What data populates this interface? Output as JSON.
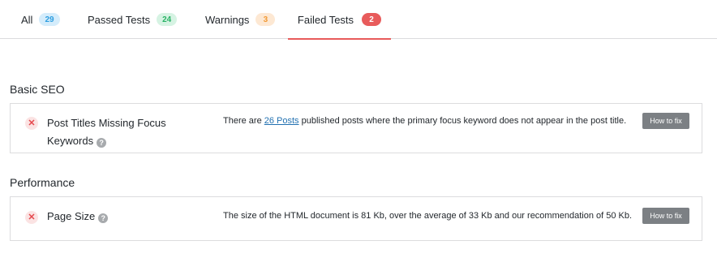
{
  "tabs": [
    {
      "label": "All",
      "count": "29",
      "color": "#2e9ee0"
    },
    {
      "label": "Passed Tests",
      "count": "24",
      "color": "#28b264"
    },
    {
      "label": "Warnings",
      "count": "3",
      "color": "#f19a36"
    },
    {
      "label": "Failed Tests",
      "count": "2",
      "color": "#e85b5b",
      "active": true
    }
  ],
  "sections": [
    {
      "title": "Basic SEO",
      "tests": [
        {
          "status_icon": "x-icon",
          "name": "Post Titles Missing Focus Keywords",
          "help_icon": "help-icon",
          "desc_before": "There are ",
          "desc_link": "26 Posts",
          "desc_after": " published posts where the primary focus keyword does not appear in the post title.",
          "button": "How to fix"
        }
      ]
    },
    {
      "title": "Performance",
      "tests": [
        {
          "status_icon": "x-icon",
          "name": "Page Size",
          "help_icon": "help-icon",
          "description": "The size of the HTML document is 81 Kb, over the average of 33 Kb and our recommendation of 50 Kb.",
          "button": "How to fix"
        }
      ]
    }
  ],
  "colors": {
    "accent_red": "#e85b5b",
    "button_gray": "#7c8084",
    "link_blue": "#2271b1"
  }
}
